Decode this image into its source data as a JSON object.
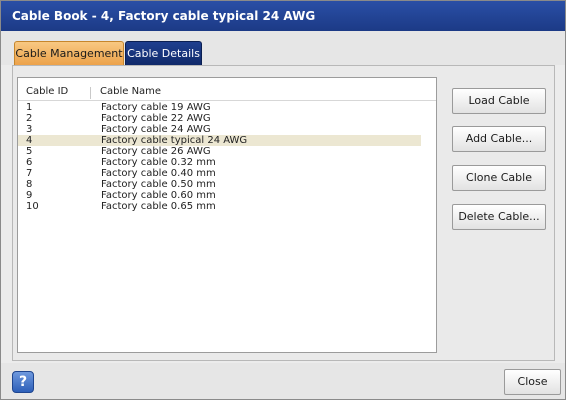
{
  "window": {
    "title": "Cable Book - 4, Factory cable typical 24 AWG"
  },
  "tabs": [
    {
      "label": "Cable Management",
      "active": true
    },
    {
      "label": "Cable Details",
      "active": false
    }
  ],
  "list": {
    "columns": {
      "id": "Cable ID",
      "name": "Cable Name"
    },
    "selected_id": "4",
    "rows": [
      {
        "id": "1",
        "name": "Factory cable 19 AWG"
      },
      {
        "id": "2",
        "name": "Factory cable 22 AWG"
      },
      {
        "id": "3",
        "name": "Factory cable 24 AWG"
      },
      {
        "id": "4",
        "name": "Factory cable typical 24 AWG"
      },
      {
        "id": "5",
        "name": "Factory cable 26 AWG"
      },
      {
        "id": "6",
        "name": "Factory cable 0.32 mm"
      },
      {
        "id": "7",
        "name": "Factory cable 0.40 mm"
      },
      {
        "id": "8",
        "name": "Factory cable 0.50 mm"
      },
      {
        "id": "9",
        "name": "Factory cable 0.60 mm"
      },
      {
        "id": "10",
        "name": "Factory cable 0.65 mm"
      }
    ]
  },
  "actions": {
    "load": "Load Cable",
    "add": "Add Cable...",
    "clone": "Clone Cable",
    "delete": "Delete Cable..."
  },
  "footer": {
    "help_icon": "question-mark",
    "help_glyph": "?",
    "close": "Close"
  },
  "colors": {
    "titlebar": "#1f3f94",
    "active_tab": "#eca24a",
    "inactive_tab": "#102a6a",
    "selected_row": "#ece7d2"
  }
}
